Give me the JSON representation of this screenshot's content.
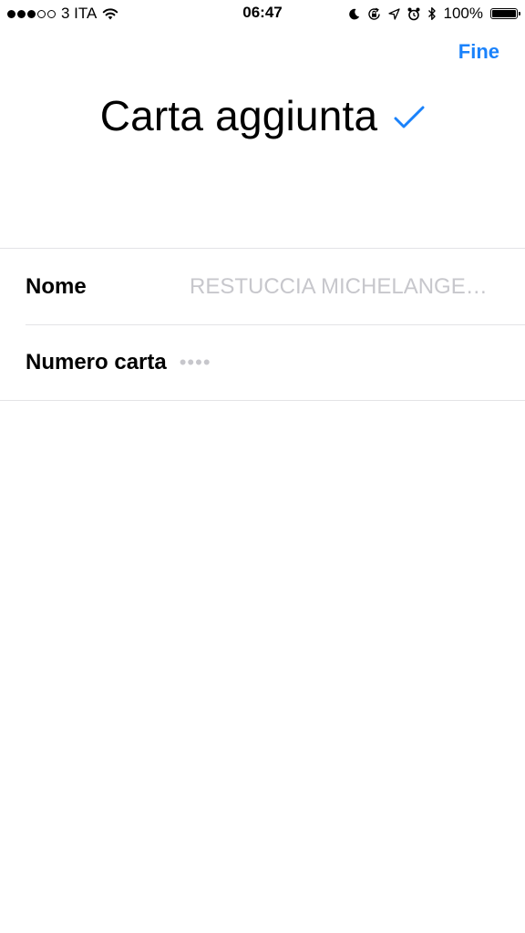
{
  "status_bar": {
    "carrier": "3 ITA",
    "time": "06:47",
    "battery": "100%",
    "battery_level": 1.0,
    "signal_bars_filled": 3,
    "signal_bars_total": 5
  },
  "nav": {
    "done_label": "Fine"
  },
  "header": {
    "title": "Carta aggiunta"
  },
  "form": {
    "name": {
      "label": "Nome",
      "value": "RESTUCCIA MICHELANGE…"
    },
    "card_number": {
      "label": "Numero carta",
      "value": "••••"
    }
  },
  "colors": {
    "accent": "#1a82fb",
    "placeholder": "#c7c7cc",
    "separator": "#e3e3e6"
  }
}
